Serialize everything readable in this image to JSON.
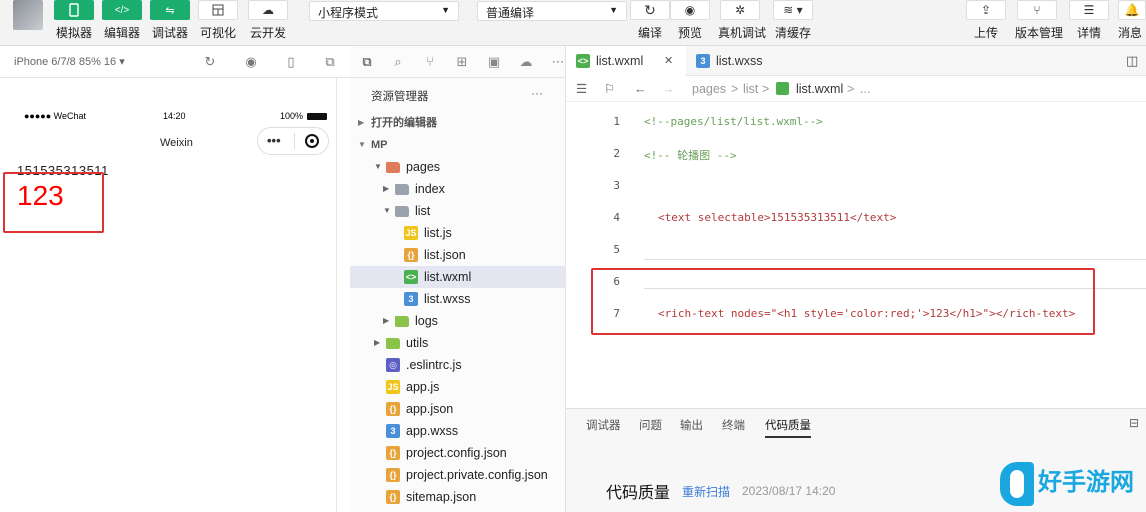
{
  "toolbar": {
    "buttons": [
      {
        "label": "模拟器",
        "icon": "phone-icon"
      },
      {
        "label": "编辑器",
        "icon": "code-icon"
      },
      {
        "label": "调试器",
        "icon": "sliders-icon"
      },
      {
        "label": "可视化",
        "icon": "layout-icon"
      },
      {
        "label": "云开发",
        "icon": "cloud-icon"
      }
    ],
    "mode_select": "小程序模式",
    "compile_select": "普通编译",
    "right_buttons": [
      {
        "label": "编译",
        "icon": "refresh-icon"
      },
      {
        "label": "预览",
        "icon": "eye-icon"
      },
      {
        "label": "真机调试",
        "icon": "bug-icon"
      },
      {
        "label": "清缓存",
        "icon": "layers-icon"
      },
      {
        "label": "上传",
        "icon": "upload-icon"
      },
      {
        "label": "版本管理",
        "icon": "branch-icon"
      },
      {
        "label": "详情",
        "icon": "menu-icon"
      },
      {
        "label": "消息",
        "icon": "bell-icon"
      }
    ]
  },
  "simulator": {
    "device": "iPhone 6/7/8 85% 16 ▾",
    "status_left": "●●●●● WeChat",
    "status_time": "14:20",
    "status_battery": "100%",
    "nav_title": "Weixin",
    "text_content": "151535313511",
    "rich_text": "123"
  },
  "explorer": {
    "title": "资源管理器",
    "more": "···",
    "open_editors": "打开的编辑器",
    "project": "MP",
    "tree": [
      {
        "name": "pages",
        "type": "folder-open",
        "depth": 0
      },
      {
        "name": "index",
        "type": "folder",
        "depth": 1
      },
      {
        "name": "list",
        "type": "folder-open",
        "depth": 1
      },
      {
        "name": "list.js",
        "type": "js",
        "depth": 2
      },
      {
        "name": "list.json",
        "type": "json",
        "depth": 2
      },
      {
        "name": "list.wxml",
        "type": "wxml",
        "depth": 2,
        "selected": true
      },
      {
        "name": "list.wxss",
        "type": "wxss",
        "depth": 2
      },
      {
        "name": "logs",
        "type": "folder",
        "depth": 1
      },
      {
        "name": "utils",
        "type": "folder",
        "depth": 0
      },
      {
        "name": ".eslintrc.js",
        "type": "eslint",
        "depth": 0
      },
      {
        "name": "app.js",
        "type": "js",
        "depth": 0
      },
      {
        "name": "app.json",
        "type": "json",
        "depth": 0
      },
      {
        "name": "app.wxss",
        "type": "wxss",
        "depth": 0
      },
      {
        "name": "project.config.json",
        "type": "json",
        "depth": 0
      },
      {
        "name": "project.private.config.json",
        "type": "json",
        "depth": 0
      },
      {
        "name": "sitemap.json",
        "type": "json",
        "depth": 0
      }
    ]
  },
  "editor": {
    "tabs": [
      {
        "name": "list.wxml",
        "active": true,
        "close": "✕"
      },
      {
        "name": "list.wxss",
        "active": false
      }
    ],
    "breadcrumb": [
      "pages",
      "list",
      "list.wxml",
      "..."
    ],
    "lines": [
      {
        "n": "1",
        "text": "<!--pages/list/list.wxml-->"
      },
      {
        "n": "2",
        "text": "<!-- 轮播图 -->"
      },
      {
        "n": "3",
        "text": ""
      },
      {
        "n": "4",
        "text": "<text selectable>151535313511</text>"
      },
      {
        "n": "5",
        "text": ""
      },
      {
        "n": "6",
        "text": ""
      },
      {
        "n": "7",
        "text": "<rich-text nodes=\"<h1 style='color:red;'>123</h1>\"></rich-text>"
      }
    ]
  },
  "panel": {
    "tabs": [
      "调试器",
      "问题",
      "输出",
      "终端",
      "代码质量"
    ],
    "heading": "代码质量",
    "rescan": "重新扫描",
    "timestamp": "2023/08/17 14:20"
  },
  "watermark": {
    "text": "好手游网"
  }
}
